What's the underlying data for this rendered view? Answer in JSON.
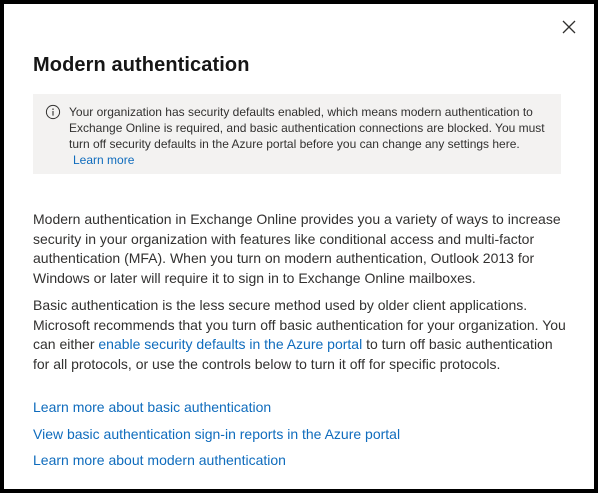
{
  "dialog": {
    "title": "Modern authentication",
    "close_icon": "close-icon"
  },
  "banner": {
    "icon": "info-icon",
    "text": "Your organization has security defaults enabled, which means modern authentication to Exchange Online is required, and basic authentication connections are blocked. You must turn off security defaults in the Azure portal before you can change any settings here.",
    "link": "Learn more"
  },
  "body": {
    "paragraph1": "Modern authentication in Exchange Online provides you a variety of ways to increase security in your organization with features like conditional access and multi-factor authentication (MFA). When you turn on modern authentication, Outlook 2013 for Windows or later will require it to sign in to Exchange Online mailboxes.",
    "paragraph2_before": "Basic authentication is the less secure method used by older client applications. Microsoft recommends that you turn off basic authentication for your organization. You can either ",
    "paragraph2_link": "enable security defaults in the Azure portal",
    "paragraph2_after": " to turn off basic authentication for all protocols, or use the controls below to turn it off for specific protocols."
  },
  "links": {
    "basic_auth": "Learn more about basic authentication",
    "sign_in_reports": "View basic authentication sign-in reports in the Azure portal",
    "modern_auth": "Learn more about modern authentication"
  },
  "colors": {
    "link": "#0f6cbd",
    "banner_bg": "#f3f2f1",
    "text": "#323130"
  }
}
